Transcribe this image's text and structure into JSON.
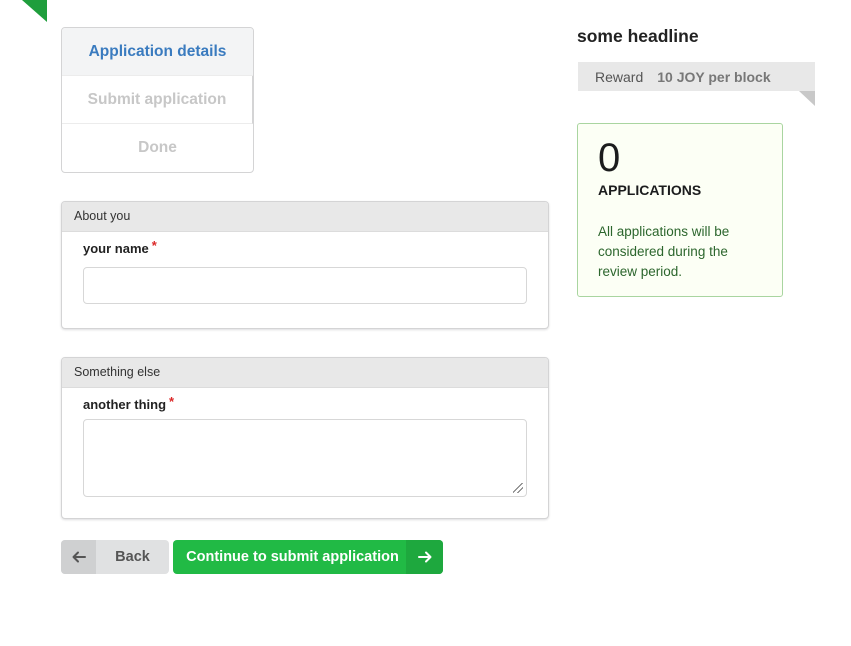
{
  "steps": [
    {
      "label": "Application details",
      "active": true
    },
    {
      "label": "Submit application",
      "active": false
    },
    {
      "label": "Done",
      "active": false
    }
  ],
  "sections": [
    {
      "title": "About you",
      "field_label": "your name",
      "required_mark": "*",
      "value": ""
    },
    {
      "title": "Something else",
      "field_label": "another thing",
      "required_mark": "*",
      "value": ""
    }
  ],
  "buttons": {
    "back_label": "Back",
    "back_icon": "arrow-left-icon",
    "continue_label": "Continue to submit application",
    "continue_icon": "arrow-right-icon"
  },
  "sidebar": {
    "headline": "some headline",
    "reward_key": "Reward",
    "reward_value": "10 JOY per block",
    "applications_count": "0",
    "applications_label": "APPLICATIONS",
    "note": "All applications will be considered during the review period."
  },
  "colors": {
    "accent_blue": "#3a7bbf",
    "primary_green": "#21ba45",
    "positive_text": "#2c662d",
    "required_red": "#db2828"
  }
}
